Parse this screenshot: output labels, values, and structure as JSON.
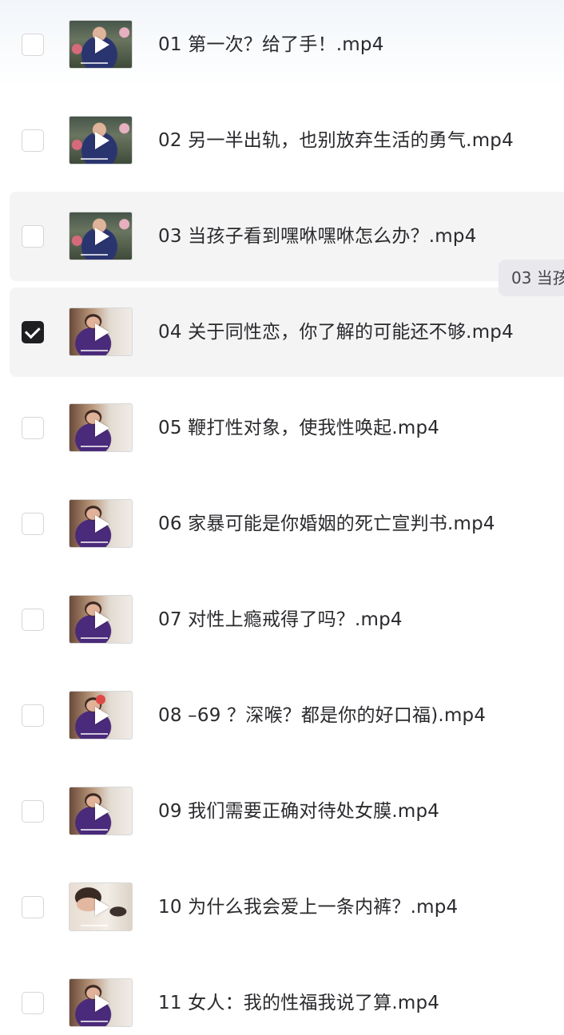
{
  "files": [
    {
      "name": "01 第一次？给了手！.mp4",
      "checked": false,
      "thumb": "style-a"
    },
    {
      "name": "02 另一半出轨，也别放弃生活的勇气.mp4",
      "checked": false,
      "thumb": "style-a"
    },
    {
      "name": "03 当孩子看到嘿咻嘿咻怎么办？.mp4",
      "checked": false,
      "thumb": "style-a"
    },
    {
      "name": "04 关于同性恋，你了解的可能还不够.mp4",
      "checked": true,
      "thumb": "style-b"
    },
    {
      "name": "05 鞭打性对象，使我性唤起.mp4",
      "checked": false,
      "thumb": "style-b"
    },
    {
      "name": "06 家暴可能是你婚姻的死亡宣判书.mp4",
      "checked": false,
      "thumb": "style-b"
    },
    {
      "name": "07 对性上瘾戒得了吗？.mp4",
      "checked": false,
      "thumb": "style-b"
    },
    {
      "name": "08 –69 ？深喉？都是你的好口福).mp4",
      "checked": false,
      "thumb": "style-b"
    },
    {
      "name": "09 我们需要正确对待处女膜.mp4",
      "checked": false,
      "thumb": "style-b"
    },
    {
      "name": "10 为什么我会爱上一条内裤？.mp4",
      "checked": false,
      "thumb": "style-c"
    },
    {
      "name": "11 女人：我的性福我说了算.mp4",
      "checked": false,
      "thumb": "style-b"
    }
  ],
  "hovered_row": 2,
  "tooltip": {
    "text": "03 当孩"
  },
  "colors": {
    "row_highlight": "#f4f4f5",
    "checkbox_checked": "#1f1f22",
    "text": "#2a2a2e",
    "tooltip_bg": "#e9e8ec"
  },
  "icons": {
    "checkbox": "check-icon",
    "play": "play-icon"
  }
}
